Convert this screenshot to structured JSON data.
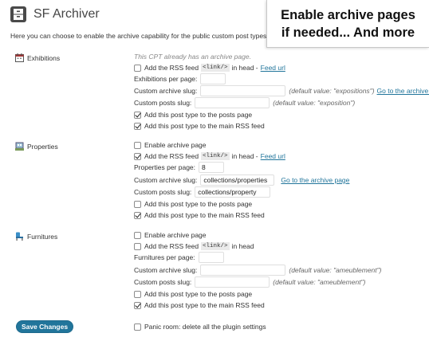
{
  "header": {
    "title": "SF Archiver",
    "intro": "Here you can choose to enable the archive capability for the public custom post types."
  },
  "callout": {
    "line1": "Enable archive pages",
    "line2": "if needed... And more"
  },
  "common": {
    "rss_pre": "Add the RSS feed",
    "rss_tag": "<link/>",
    "rss_post": "in head",
    "rss_sep": "in head -",
    "feed_link": "Feed url",
    "archive_link": "Go to the archive page",
    "archive_slug_label": "Custom archive slug:",
    "posts_slug_label": "Custom posts slug:",
    "add_posts_page": "Add this post type to the posts page",
    "add_rss_feed": "Add this post type to the main RSS feed",
    "enable_archive": "Enable archive page"
  },
  "exhibitions": {
    "label": "Exhibitions",
    "note": "This CPT already has an archive page.",
    "per_page_label": "Exhibitions per page:",
    "per_page_value": "",
    "archive_slug_value": "",
    "archive_default": "(default value: \"expositions\")",
    "posts_slug_value": "",
    "posts_default": "(default value: \"exposition\")"
  },
  "properties": {
    "label": "Properties",
    "per_page_label": "Properties per page:",
    "per_page_value": "8",
    "archive_slug_value": "collections/properties",
    "posts_slug_value": "collections/property"
  },
  "furnitures": {
    "label": "Furnitures",
    "per_page_label": "Furnitures per page:",
    "per_page_value": "",
    "archive_slug_value": "",
    "archive_default": "(default value: \"ameublement\")",
    "posts_slug_value": "",
    "posts_default": "(default value: \"ameublement\")"
  },
  "footer": {
    "save_label": "Save Changes",
    "panic_label": "Panic room: delete all the plugin settings"
  },
  "colors": {
    "accent": "#21759b",
    "link": "#21759b"
  },
  "icons": {
    "title": "archive-icon",
    "exhibitions": "calendar-icon",
    "properties": "building-icon",
    "furnitures": "chair-icon"
  }
}
